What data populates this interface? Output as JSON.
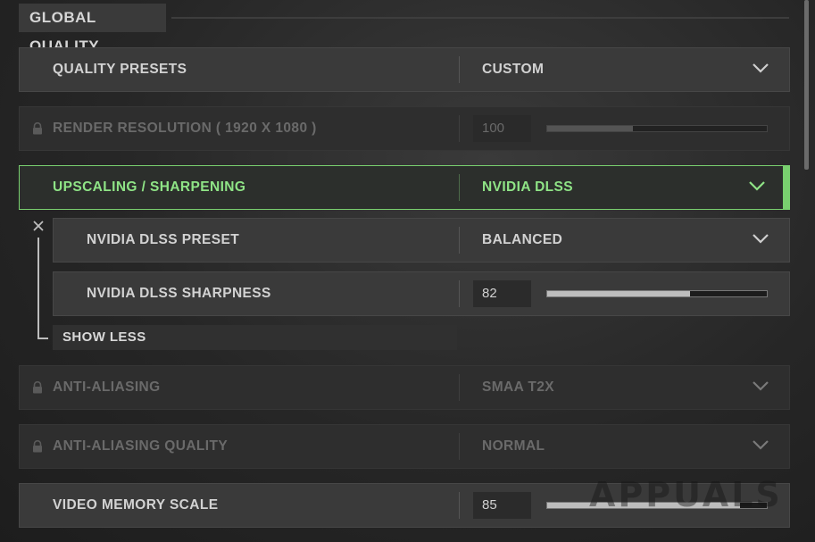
{
  "section": {
    "title": "GLOBAL QUALITY"
  },
  "settings": {
    "quality_presets": {
      "label": "QUALITY PRESETS",
      "value": "CUSTOM"
    },
    "render_resolution": {
      "label": "RENDER RESOLUTION ( 1920 X 1080 )",
      "value": "100",
      "slider_fraction": 0.39
    },
    "upscaling": {
      "label": "UPSCALING / SHARPENING",
      "value": "NVIDIA DLSS"
    },
    "dlss_preset": {
      "label": "NVIDIA DLSS PRESET",
      "value": "BALANCED"
    },
    "dlss_sharpness": {
      "label": "NVIDIA DLSS SHARPNESS",
      "value": "82",
      "slider_fraction": 0.65
    },
    "show_less": {
      "label": "SHOW LESS"
    },
    "anti_aliasing": {
      "label": "ANTI-ALIASING",
      "value": "SMAA T2X"
    },
    "anti_aliasing_quality": {
      "label": "ANTI-ALIASING QUALITY",
      "value": "NORMAL"
    },
    "video_memory_scale": {
      "label": "VIDEO MEMORY SCALE",
      "value": "85",
      "slider_fraction": 0.88
    }
  },
  "colors": {
    "accent_green": "#79d06f",
    "active_text": "#8fe486",
    "locked_text": "#6a6a6a"
  },
  "watermark": {
    "text": "APPUALS"
  }
}
